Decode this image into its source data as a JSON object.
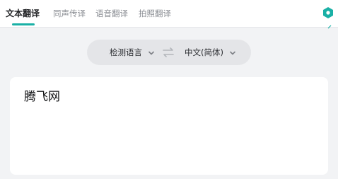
{
  "tabs": [
    {
      "label": "文本翻译",
      "active": true
    },
    {
      "label": "同声传译",
      "active": false
    },
    {
      "label": "语音翻译",
      "active": false
    },
    {
      "label": "拍照翻译",
      "active": false
    }
  ],
  "lang_bar": {
    "source": "检测语言",
    "target": "中文(简体)"
  },
  "input": {
    "value": "腾飞网"
  },
  "colors": {
    "accent": "#1ab0a6",
    "page_bg": "#f2f3f5",
    "pill_bg": "#e4e5e8"
  },
  "icons": {
    "settings": "hexagon-settings-icon",
    "swap": "swap-arrows-icon",
    "dropdown": "chevron-down-icon"
  }
}
